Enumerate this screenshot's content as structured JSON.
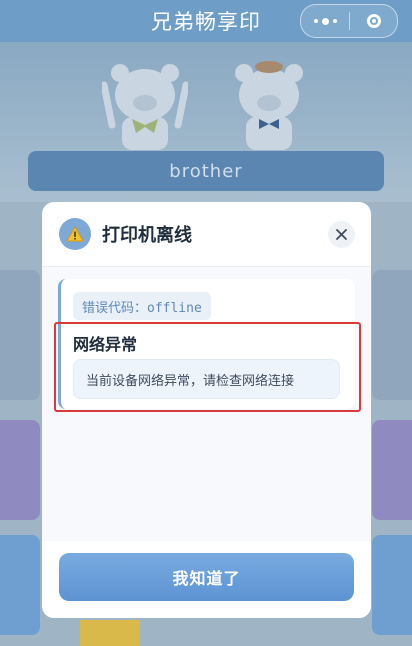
{
  "app": {
    "title": "兄弟畅享印"
  },
  "background": {
    "brand_banner": "brother"
  },
  "dialog": {
    "title": "打印机离线",
    "warning_icon": "warning-icon",
    "close_icon": "close-icon",
    "error_code_label": "错误代码：offline",
    "error_title": "网络异常",
    "error_description": "当前设备网络异常，请检查网络连接",
    "confirm_button": "我知道了"
  },
  "colors": {
    "accent": "#6e9ec7",
    "highlight_border": "#d93a3a",
    "button": "#5c93d2"
  }
}
